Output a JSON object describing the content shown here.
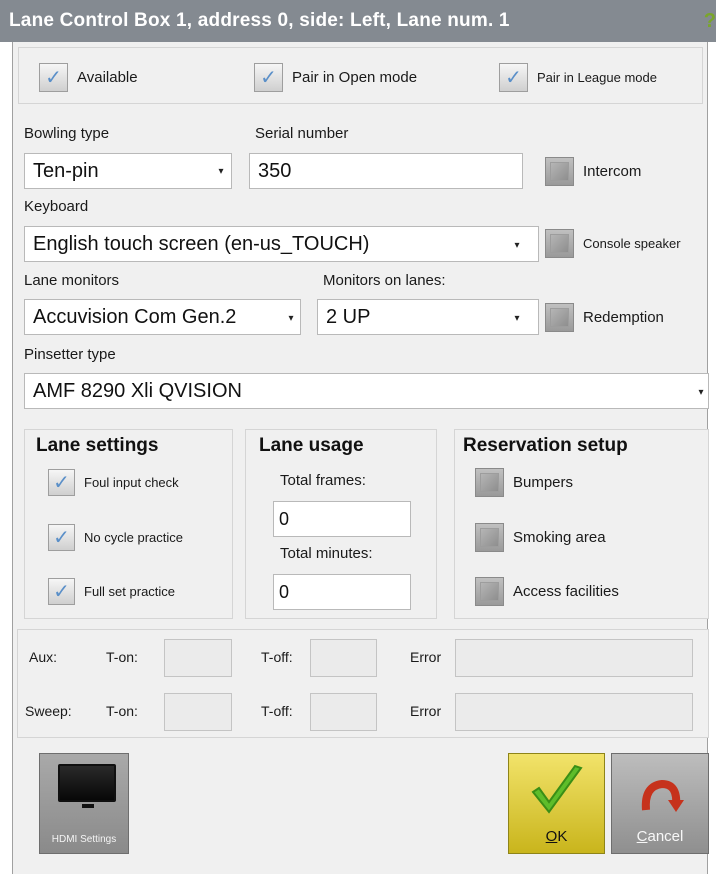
{
  "window": {
    "title": "Lane Control Box 1, address 0, side: Left, Lane num. 1",
    "help_icon": "help-icon"
  },
  "top_options": [
    {
      "label": "Available",
      "checked": true
    },
    {
      "label": "Pair in Open mode",
      "checked": true
    },
    {
      "label": "Pair in League mode",
      "checked": true
    }
  ],
  "bowling_type": {
    "label": "Bowling type",
    "value": "Ten-pin"
  },
  "serial_number": {
    "label": "Serial number",
    "value": "350"
  },
  "intercom": {
    "label": "Intercom",
    "checked": false
  },
  "keyboard": {
    "label": "Keyboard",
    "value": "English touch screen (en-us_TOUCH)"
  },
  "console_speaker": {
    "label": "Console speaker",
    "checked": false
  },
  "lane_monitors": {
    "label": "Lane monitors",
    "value": "Accuvision Com Gen.2"
  },
  "monitors_on_lanes": {
    "label": "Monitors on lanes:",
    "value": "2 UP"
  },
  "redemption": {
    "label": "Redemption",
    "checked": false
  },
  "pinsetter_type": {
    "label": "Pinsetter type",
    "value": "AMF 8290 Xli QVISION"
  },
  "lane_settings": {
    "title": "Lane settings",
    "items": [
      {
        "label": "Foul input check",
        "checked": true
      },
      {
        "label": "No cycle practice",
        "checked": true
      },
      {
        "label": "Full set practice",
        "checked": true
      }
    ]
  },
  "lane_usage": {
    "title": "Lane usage",
    "total_frames_label": "Total frames:",
    "total_frames_value": "0",
    "total_minutes_label": "Total minutes:",
    "total_minutes_value": "0"
  },
  "reservation_setup": {
    "title": "Reservation setup",
    "items": [
      {
        "label": "Bumpers",
        "checked": false
      },
      {
        "label": "Smoking area",
        "checked": false
      },
      {
        "label": "Access facilities",
        "checked": false
      }
    ]
  },
  "aux": {
    "label": "Aux:",
    "ton_label": "T-on:",
    "toff_label": "T-off:",
    "error_label": "Error",
    "ton_value": "",
    "toff_value": "",
    "error_value": ""
  },
  "sweep": {
    "label": "Sweep:",
    "ton_label": "T-on:",
    "toff_label": "T-off:",
    "error_label": "Error",
    "ton_value": "",
    "toff_value": "",
    "error_value": ""
  },
  "buttons": {
    "hdmi_label": "HDMI Settings",
    "ok_mnemonic": "O",
    "ok_rest": "K",
    "cancel_mnemonic": "C",
    "cancel_rest": "ancel"
  },
  "colors": {
    "titlebar": "#848a91",
    "ok_button": "#e6d43a",
    "check_tick": "#5a8fc8",
    "ok_check": "#5ebd2a",
    "cancel_arrow": "#c6321c"
  }
}
